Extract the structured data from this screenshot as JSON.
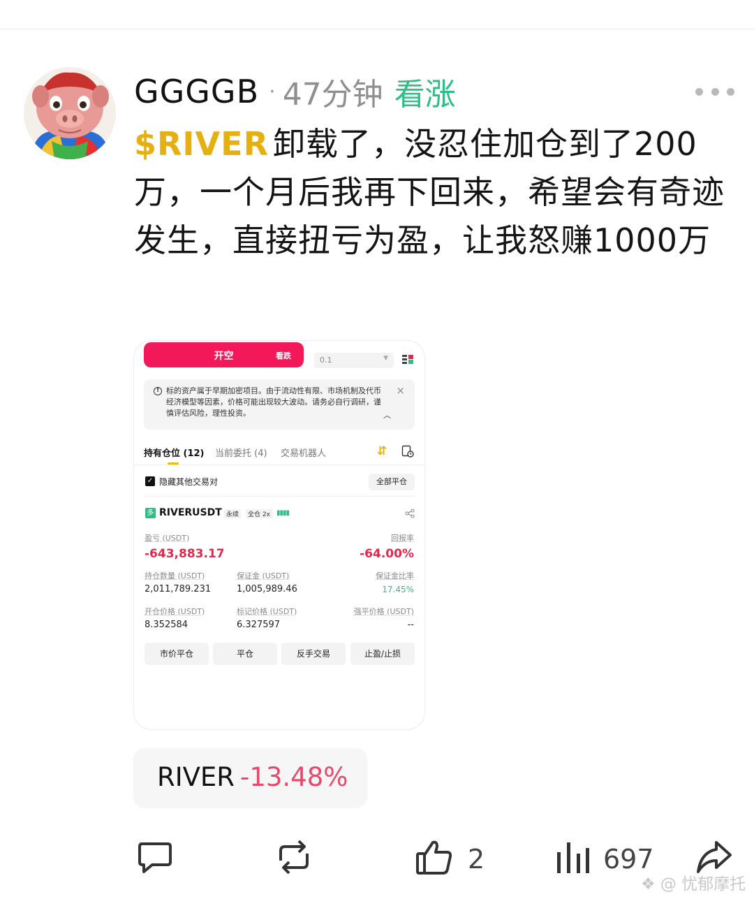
{
  "post": {
    "username": "GGGGB",
    "separator": "·",
    "time": "47分钟",
    "sentiment": "看涨",
    "ticker": "$RIVER",
    "text": "卸载了，没忍住加仓到了200万，一个月后我再下回来，希望会有奇迹发生，直接扭亏为盈，让我怒赚1000万"
  },
  "screenshot": {
    "short_button": {
      "label": "开空",
      "sub": "看跌"
    },
    "quantity": "0.1",
    "notice": "标的资产属于早期加密项目。由于流动性有限、市场机制及代币经济模型等因素，价格可能出现较大波动。请务必自行调研，谨慎评估风险，理性投资。",
    "tabs": [
      "持有仓位 (12)",
      "当前委托 (4)",
      "交易机器人"
    ],
    "hide_label": "隐藏其他交易对",
    "close_all": "全部平仓",
    "position": {
      "side_tag": "多",
      "pair": "RIVERUSDT",
      "type": "永续",
      "margin_mode": "全仓 2x",
      "pnl_label": "盈亏 (USDT)",
      "pnl_value": "-643,883.17",
      "roe_label": "回报率",
      "roe_value": "-64.00%",
      "size_label": "持仓数量 (USDT)",
      "size_value": "2,011,789.231",
      "margin_label": "保证金 (USDT)",
      "margin_value": "1,005,989.46",
      "margin_ratio_label": "保证金比率",
      "margin_ratio_value": "17.45%",
      "entry_label": "开仓价格 (USDT)",
      "entry_value": "8.352584",
      "mark_label": "标记价格 (USDT)",
      "mark_value": "6.327597",
      "liq_label": "强平价格 (USDT)",
      "liq_value": "--"
    },
    "actions": [
      "市价平仓",
      "平仓",
      "反手交易",
      "止盈/止损"
    ]
  },
  "token_chip": {
    "name": "RIVER",
    "change": "-13.48%"
  },
  "action_bar": {
    "like_count": "2",
    "view_count": "697"
  },
  "watermark": "忧郁摩托",
  "colors": {
    "sentiment": "#2ebd85",
    "ticker": "#e6b012",
    "negative": "#e8486a",
    "short": "#f2185a"
  }
}
